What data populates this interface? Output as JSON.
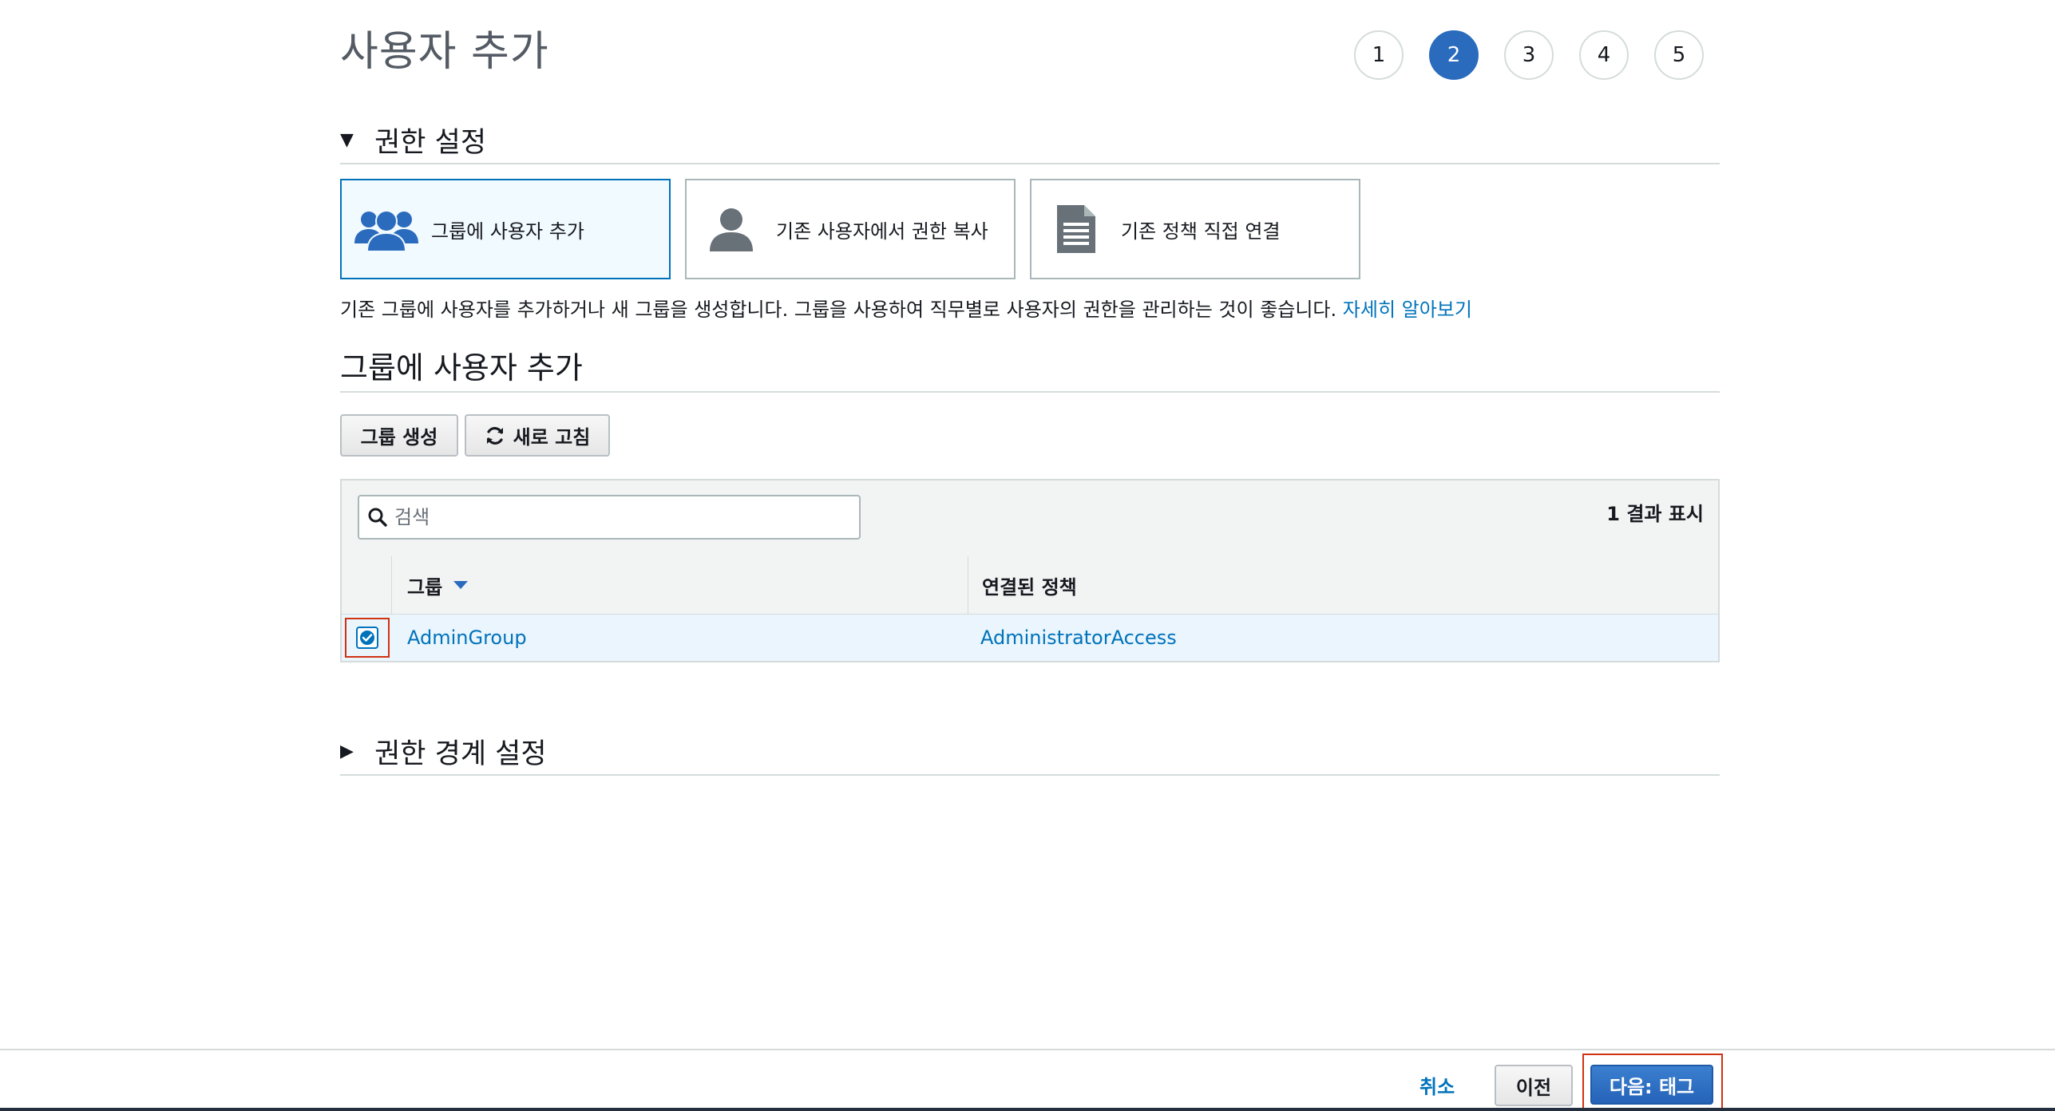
{
  "page": {
    "title": "사용자 추가"
  },
  "steps": [
    "1",
    "2",
    "3",
    "4",
    "5"
  ],
  "active_step": "2",
  "permissions_section": {
    "title": "권한 설정",
    "options": [
      {
        "label": "그룹에 사용자 추가",
        "icon": "users-group-icon",
        "selected": true
      },
      {
        "label": "기존 사용자에서 권한 복사",
        "icon": "user-icon",
        "selected": false
      },
      {
        "label": "기존 정책 직접 연결",
        "icon": "document-icon",
        "selected": false
      }
    ],
    "description": "기존 그룹에 사용자를 추가하거나 새 그룹을 생성합니다. 그룹을 사용하여 직무별로 사용자의 권한을 관리하는 것이 좋습니다.",
    "learn_more": "자세히 알아보기"
  },
  "group_section": {
    "title": "그룹에 사용자 추가",
    "create_group_button": "그룹 생성",
    "refresh_button": "새로 고침",
    "search_placeholder": "검색",
    "result_count": "1 결과 표시",
    "columns": [
      "그룹",
      "연결된 정책"
    ],
    "rows": [
      {
        "checked": true,
        "group": "AdminGroup",
        "policy": "AdministratorAccess"
      }
    ]
  },
  "boundary_section": {
    "title": "권한 경계 설정"
  },
  "footer": {
    "cancel": "취소",
    "previous": "이전",
    "next": "다음: 태그"
  },
  "colors": {
    "accent": "#2a6bbd",
    "link": "#0073bb",
    "highlight_border": "#d13212",
    "selected_bg": "#f1faff",
    "row_bg": "#eaf5fd"
  }
}
